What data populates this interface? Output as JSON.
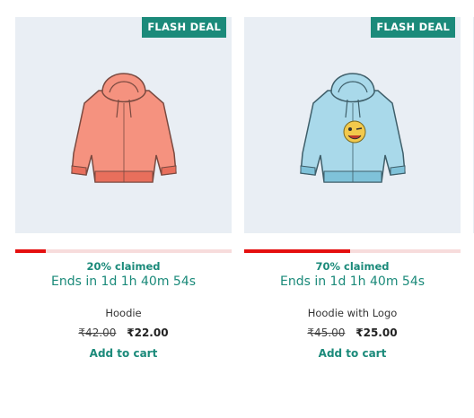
{
  "products": [
    {
      "badge": "FLASH DEAL",
      "claimed_percent": 20,
      "claimed_text": "20% claimed",
      "timer": "Ends in 1d 1h 40m 54s",
      "name": "Hoodie",
      "old_price": "₹42.00",
      "new_price": "₹22.00",
      "add_to_cart": "Add to cart",
      "hoodie_color": "#f5927f",
      "hoodie_shade": "#e86f5c",
      "has_logo": false
    },
    {
      "badge": "FLASH DEAL",
      "claimed_percent": 70,
      "claimed_text": "70% claimed",
      "timer": "Ends in 1d 1h 40m 54s",
      "name": "Hoodie with Logo",
      "old_price": "₹45.00",
      "new_price": "₹25.00",
      "add_to_cart": "Add to cart",
      "hoodie_color": "#a9d9ea",
      "hoodie_shade": "#7fc2d9",
      "has_logo": true
    }
  ],
  "colors": {
    "accent": "#1b8a7a",
    "progress_fill": "#e50f0f",
    "progress_track": "#f7dcdc",
    "thumb_bg": "#e9eef4"
  }
}
